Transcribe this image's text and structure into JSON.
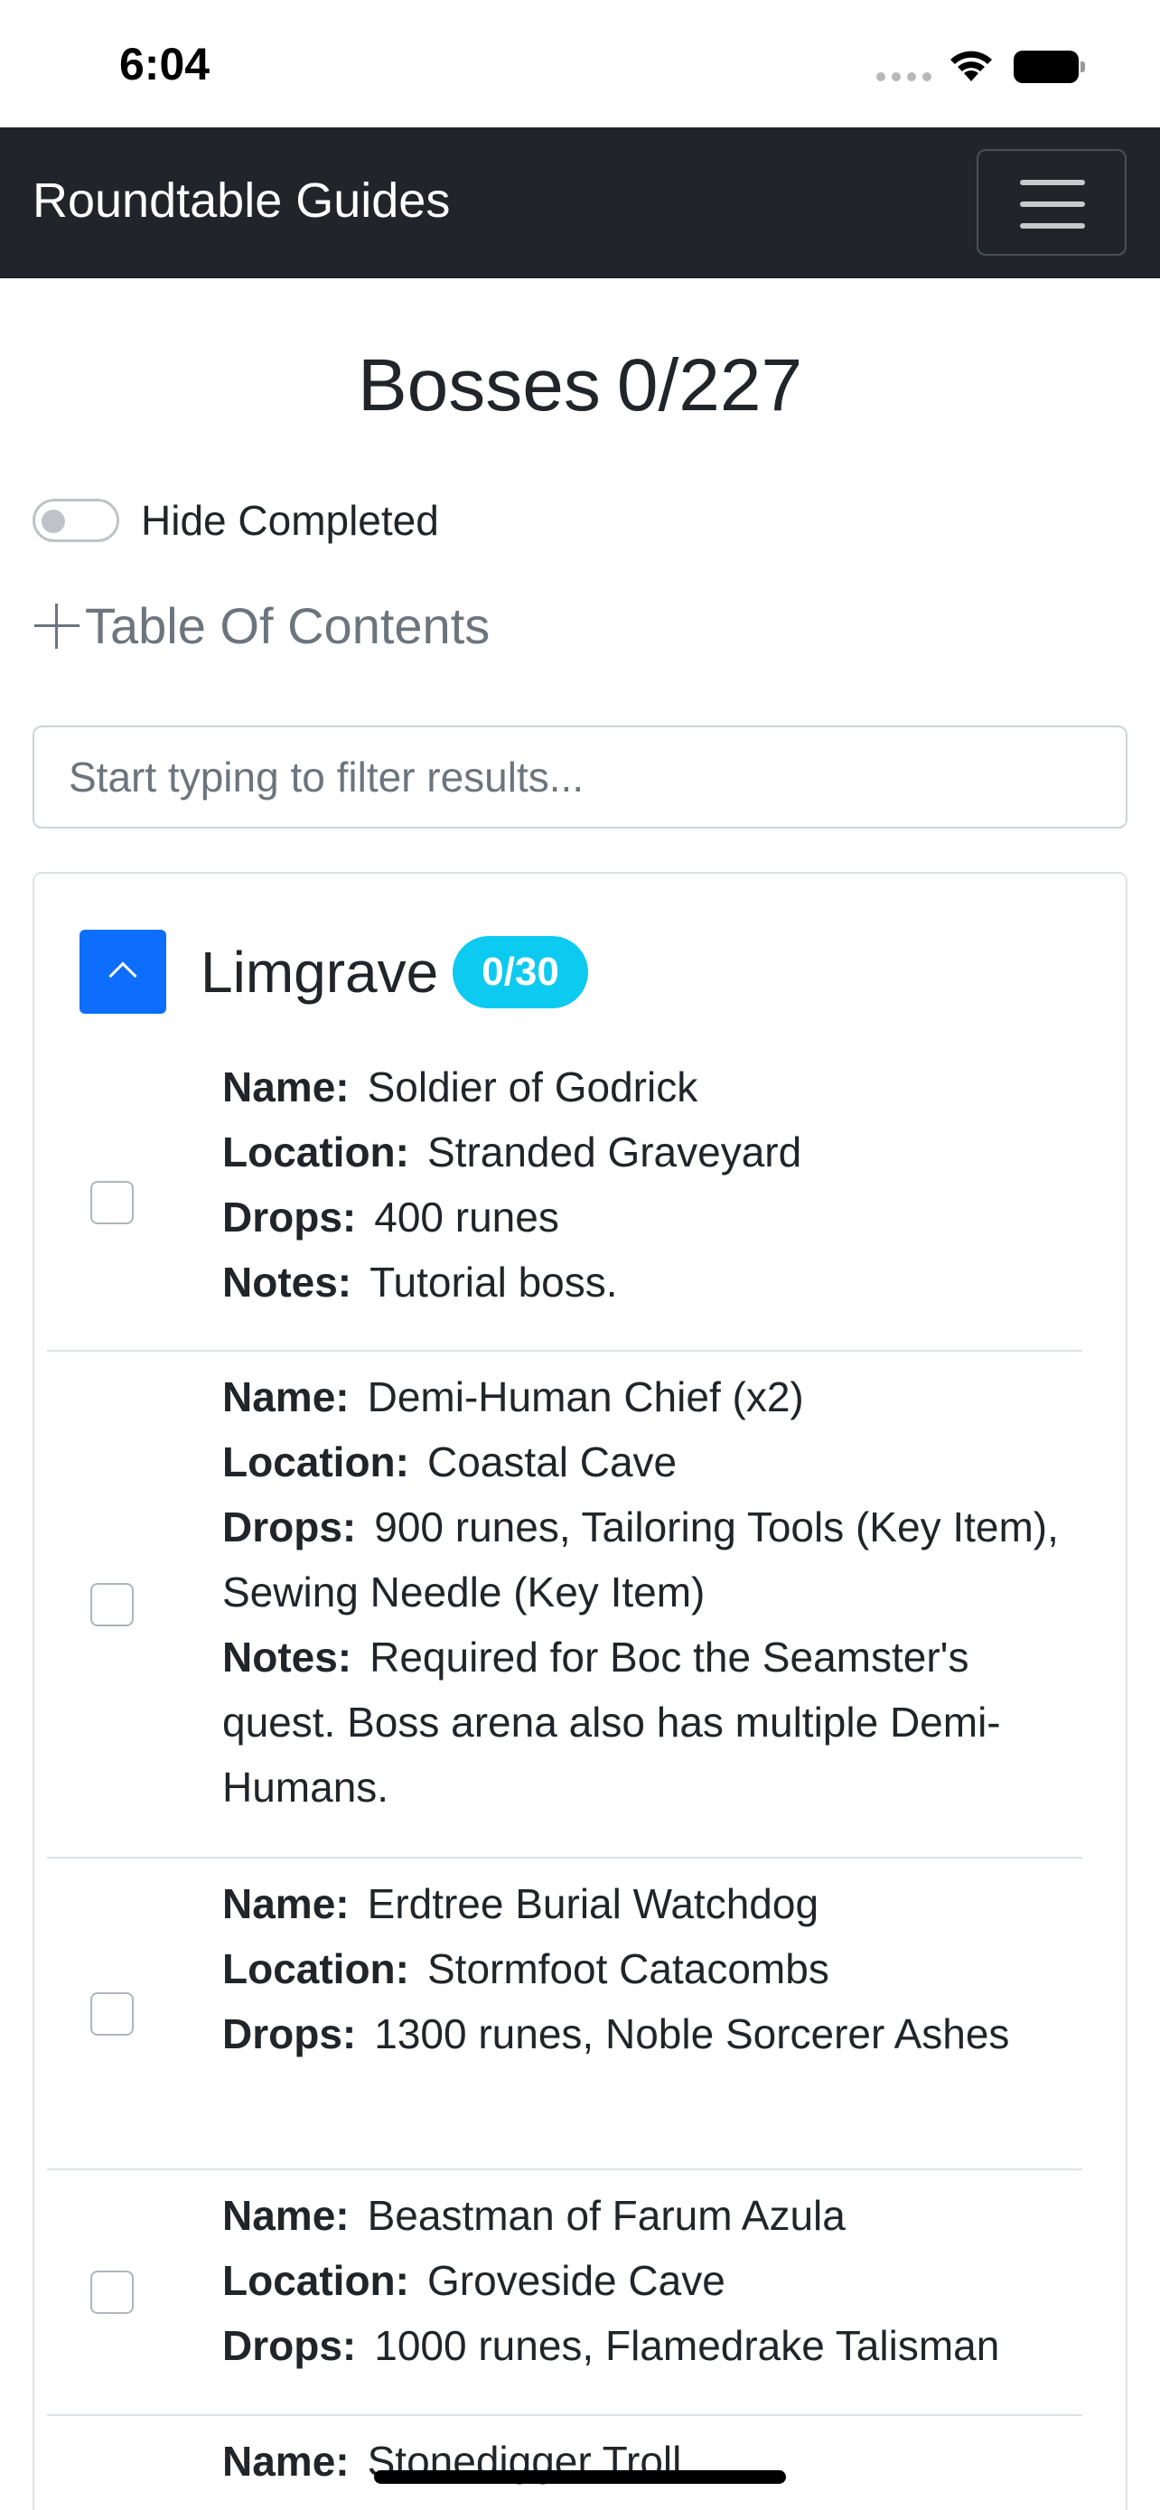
{
  "status_bar": {
    "time": "6:04"
  },
  "navbar": {
    "brand": "Roundtable Guides"
  },
  "page": {
    "title": "Bosses",
    "count": "0/227"
  },
  "hide_completed": {
    "label": "Hide Completed",
    "checked": false
  },
  "toc": {
    "label": "Table Of Contents"
  },
  "filter": {
    "placeholder": "Start typing to filter results..."
  },
  "section": {
    "title": "Limgrave",
    "badge": "0/30",
    "bosses": [
      {
        "name_label": "Name:",
        "name": "Soldier of Godrick",
        "location_label": "Location:",
        "location": "Stranded Graveyard",
        "drops_label": "Drops:",
        "drops": "400 runes",
        "notes_label": "Notes:",
        "notes": "Tutorial boss."
      },
      {
        "name_label": "Name:",
        "name": "Demi-Human Chief (x2)",
        "location_label": "Location:",
        "location": "Coastal Cave",
        "drops_label": "Drops:",
        "drops": "900 runes, Tailoring Tools (Key Item), Sewing Needle (Key Item)",
        "notes_label": "Notes:",
        "notes": "Required for Boc the Seamster's quest. Boss arena also has multiple Demi-Humans."
      },
      {
        "name_label": "Name:",
        "name": "Erdtree Burial Watchdog",
        "location_label": "Location:",
        "location": "Stormfoot Catacombs",
        "drops_label": "Drops:",
        "drops": "1300 runes, Noble Sorcerer Ashes"
      },
      {
        "name_label": "Name:",
        "name": "Beastman of Farum Azula",
        "location_label": "Location:",
        "location": "Groveside Cave",
        "drops_label": "Drops:",
        "drops": "1000 runes, Flamedrake Talisman"
      },
      {
        "name_label": "Name:",
        "name": "Stonedigger Troll"
      }
    ]
  },
  "colors": {
    "navbar": "#212529",
    "primary": "#0d6efd",
    "badge": "#0dcaf0"
  }
}
